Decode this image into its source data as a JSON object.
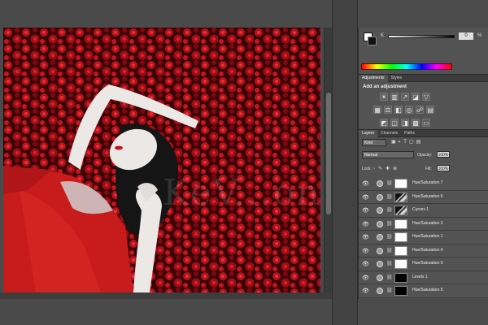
{
  "colors": {
    "accent_red": "#c0141c",
    "panel_bg": "#535353",
    "workspace_bg": "#4a4a4a"
  },
  "watermark": "KeV...on",
  "color_panel": {
    "channel_label": "K",
    "value": "0",
    "unit": "%"
  },
  "adjustments_tabs": [
    "Adjustments",
    "Styles"
  ],
  "adjustments": {
    "title": "Add an adjustment",
    "row1": [
      {
        "icon": "brightness-icon",
        "glyph": "☀"
      },
      {
        "icon": "levels-icon",
        "glyph": "▥"
      },
      {
        "icon": "curves-icon",
        "glyph": "↗"
      },
      {
        "icon": "exposure-icon",
        "glyph": "◪"
      },
      {
        "icon": "vibrance-icon",
        "glyph": "▽"
      }
    ],
    "row2": [
      {
        "icon": "hue-saturation-icon",
        "glyph": "▦"
      },
      {
        "icon": "color-balance-icon",
        "glyph": "⚖"
      },
      {
        "icon": "black-white-icon",
        "glyph": "◧"
      },
      {
        "icon": "photo-filter-icon",
        "glyph": "◎"
      },
      {
        "icon": "channel-mixer-icon",
        "glyph": "☍"
      },
      {
        "icon": "color-lookup-icon",
        "glyph": "▤"
      }
    ],
    "row3": [
      {
        "icon": "invert-icon",
        "glyph": "◩"
      },
      {
        "icon": "posterize-icon",
        "glyph": "◫"
      },
      {
        "icon": "threshold-icon",
        "glyph": "◨"
      },
      {
        "icon": "selective-color-icon",
        "glyph": "▩"
      },
      {
        "icon": "gradient-map-icon",
        "glyph": "▭"
      }
    ]
  },
  "layers_tabs": [
    "Layers",
    "Channels",
    "Paths"
  ],
  "layers_panel": {
    "kind": "Kind",
    "blend_mode": "Normal",
    "opacity_label": "Opacity:",
    "opacity_value": "100%",
    "lock_label": "Lock:",
    "fill_label": "Fill:",
    "fill_value": "100%"
  },
  "layers": [
    {
      "name": "Hue/Saturation 7",
      "mask": "white"
    },
    {
      "name": "Hue/Saturation 6",
      "mask": "mixed"
    },
    {
      "name": "Curves 1",
      "mask": "mixed"
    },
    {
      "name": "Hue/Saturation 2",
      "mask": "white"
    },
    {
      "name": "Hue/Saturation 1",
      "mask": "white"
    },
    {
      "name": "Hue/Saturation 4",
      "mask": "white"
    },
    {
      "name": "Hue/Saturation 3",
      "mask": "white"
    },
    {
      "name": "Levels 1",
      "mask": "black"
    },
    {
      "name": "Hue/Saturation 5",
      "mask": "black"
    }
  ]
}
